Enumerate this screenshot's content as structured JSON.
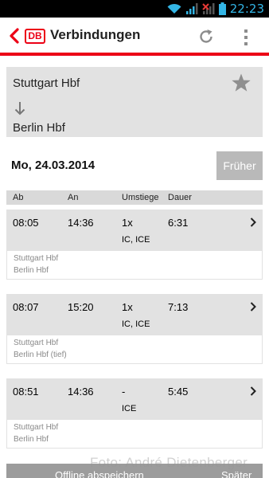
{
  "status_bar": {
    "time": "22:23",
    "icons": [
      "wifi-icon",
      "signal-icon",
      "signal-roaming-icon",
      "battery-icon"
    ],
    "time_color": "#33b5e5"
  },
  "action_bar": {
    "logo": "DB",
    "title": "Verbindungen",
    "icons": [
      "back-chevron-icon",
      "refresh-icon",
      "overflow-menu-icon"
    ],
    "accent_color": "#ec0016"
  },
  "route": {
    "from": "Stuttgart Hbf",
    "to": "Berlin Hbf",
    "icons": [
      "arrow-down-icon",
      "star-icon"
    ]
  },
  "date": "Mo, 24.03.2014",
  "earlier_button": "Früher",
  "table_header": {
    "departure": "Ab",
    "arrival": "An",
    "changes": "Umstiege",
    "duration": "Dauer"
  },
  "connections": [
    {
      "dep": "08:05",
      "arr": "14:36",
      "changes": "1x",
      "duration": "6:31",
      "products": "IC, ICE",
      "from": "Stuttgart Hbf",
      "to": "Berlin Hbf"
    },
    {
      "dep": "08:07",
      "arr": "15:20",
      "changes": "1x",
      "duration": "7:13",
      "products": "IC, ICE",
      "from": "Stuttgart Hbf",
      "to": "Berlin Hbf (tief)"
    },
    {
      "dep": "08:51",
      "arr": "14:36",
      "changes": "-",
      "duration": "5:45",
      "products": "ICE",
      "from": "Stuttgart Hbf",
      "to": "Berlin Hbf"
    }
  ],
  "bottom_bar": {
    "offline": "Offline abspeichern",
    "later": "Später"
  },
  "credit": "Foto: André Dietenberger"
}
